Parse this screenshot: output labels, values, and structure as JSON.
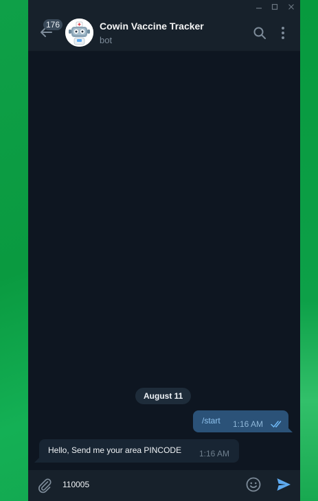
{
  "window": {
    "controls": {
      "minimize": "—",
      "maximize": "☐",
      "close": "✕"
    }
  },
  "header": {
    "unread_count": "176",
    "title": "Cowin Vaccine Tracker",
    "subtitle": "bot",
    "icons": [
      "back-arrow-icon",
      "bot-avatar",
      "search-icon",
      "more-vertical-icon"
    ]
  },
  "chat": {
    "date_label": "August 11",
    "messages": [
      {
        "direction": "outgoing",
        "text": "/start",
        "time": "1:16 AM",
        "status": "read-double-tick"
      },
      {
        "direction": "incoming",
        "text": "Hello, Send me your area PINCODE",
        "time": "1:16 AM"
      }
    ]
  },
  "composer": {
    "input_value": "110005",
    "icons": [
      "paperclip-icon",
      "emoji-icon",
      "send-icon"
    ]
  },
  "colors": {
    "accent": "#5eaaef",
    "chat_background": "#0e1621",
    "header_background": "#17212b",
    "outgoing_bubble": "#2b5278",
    "incoming_bubble": "#182533",
    "desktop_green": "#0fa048"
  }
}
